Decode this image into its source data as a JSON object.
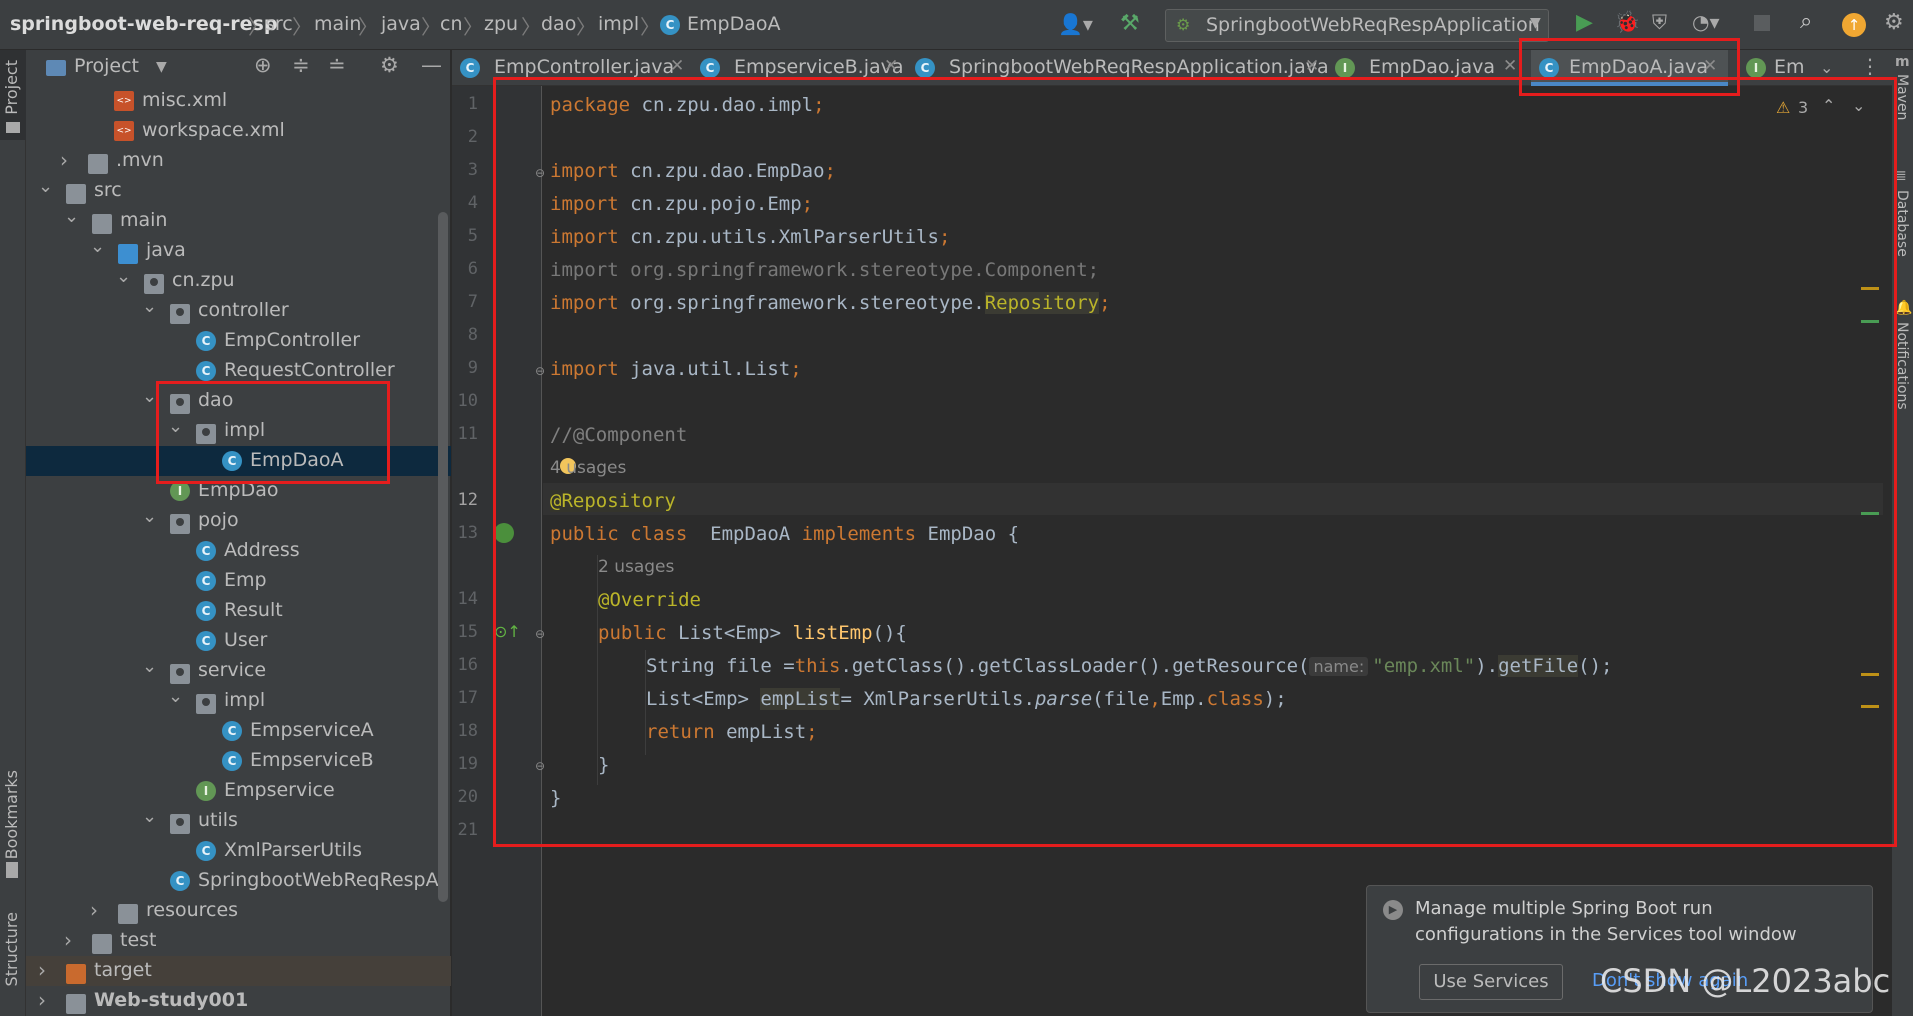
{
  "breadcrumb": {
    "project": "springboot-web-req-resp",
    "items": [
      "src",
      "main",
      "java",
      "cn",
      "zpu",
      "dao",
      "impl",
      "EmpDaoA"
    ]
  },
  "toolbar": {
    "run_config": "SpringbootWebReqRespApplication"
  },
  "left_strip": {
    "project": "Project",
    "bookmarks": "Bookmarks",
    "structure": "Structure"
  },
  "project_panel": {
    "title": "Project",
    "tree": [
      {
        "label": "misc.xml",
        "type": "xml"
      },
      {
        "label": "workspace.xml",
        "type": "xml"
      },
      {
        "label": ".mvn",
        "type": "folder"
      },
      {
        "label": "src",
        "type": "folder"
      },
      {
        "label": "main",
        "type": "folder"
      },
      {
        "label": "java",
        "type": "folder"
      },
      {
        "label": "cn.zpu",
        "type": "package"
      },
      {
        "label": "controller",
        "type": "package"
      },
      {
        "label": "EmpController",
        "type": "class"
      },
      {
        "label": "RequestController",
        "type": "class"
      },
      {
        "label": "dao",
        "type": "package"
      },
      {
        "label": "impl",
        "type": "package"
      },
      {
        "label": "EmpDaoA",
        "type": "class",
        "selected": true
      },
      {
        "label": "EmpDao",
        "type": "interface"
      },
      {
        "label": "pojo",
        "type": "package"
      },
      {
        "label": "Address",
        "type": "class"
      },
      {
        "label": "Emp",
        "type": "class"
      },
      {
        "label": "Result",
        "type": "class"
      },
      {
        "label": "User",
        "type": "class"
      },
      {
        "label": "service",
        "type": "package"
      },
      {
        "label": "impl",
        "type": "package"
      },
      {
        "label": "EmpserviceA",
        "type": "class"
      },
      {
        "label": "EmpserviceB",
        "type": "class"
      },
      {
        "label": "Empservice",
        "type": "interface"
      },
      {
        "label": "utils",
        "type": "package"
      },
      {
        "label": "XmlParserUtils",
        "type": "class"
      },
      {
        "label": "SpringbootWebReqRespA",
        "type": "class"
      },
      {
        "label": "resources",
        "type": "folder"
      },
      {
        "label": "test",
        "type": "folder"
      },
      {
        "label": "target",
        "type": "folder"
      },
      {
        "label": "Web-study001",
        "type": "folder"
      }
    ]
  },
  "tabs": [
    {
      "label": "EmpController.java",
      "icon": "class"
    },
    {
      "label": "EmpserviceB.java",
      "icon": "class"
    },
    {
      "label": "SpringbootWebReqRespApplication.java",
      "icon": "class"
    },
    {
      "label": "EmpDao.java",
      "icon": "interface"
    },
    {
      "label": "EmpDaoA.java",
      "icon": "class",
      "active": true
    },
    {
      "label": "Em",
      "icon": "interface"
    }
  ],
  "editor": {
    "warnings_count": "3",
    "line_numbers": [
      "1",
      "2",
      "3",
      "4",
      "5",
      "6",
      "7",
      "8",
      "9",
      "10",
      "11",
      "",
      "12",
      "13",
      "",
      "14",
      "15",
      "16",
      "17",
      "18",
      "19",
      "20",
      "21"
    ],
    "usages_4": "4 usages",
    "usages_2": "2 usages",
    "param_hint": "name:",
    "lines": {
      "l1": [
        "package ",
        "cn.zpu.dao.impl",
        ";"
      ],
      "l3": [
        "import ",
        "cn.zpu.dao.EmpDao",
        ";"
      ],
      "l4": [
        "import ",
        "cn.zpu.pojo.Emp",
        ";"
      ],
      "l5": [
        "import ",
        "cn.zpu.utils.XmlParserUtils",
        ";"
      ],
      "l6": "import org.springframework.stereotype.Component;",
      "l7": [
        "import ",
        "org.springframework.stereotype.",
        "Repository",
        ";"
      ],
      "l9": [
        "import ",
        "java.util.List",
        ";"
      ],
      "l11": "//@Component",
      "l12": "@Repository",
      "l13": [
        "public class ",
        " EmpDaoA ",
        "implements ",
        "EmpDao {"
      ],
      "l14": "@Override",
      "l15": [
        "public ",
        "List<Emp> ",
        "listEmp",
        "(){"
      ],
      "l16": [
        "String file =",
        "this",
        ".getClass().getClassLoader().getResource(",
        "\"emp.xml\"",
        ").",
        "getFile",
        "();"
      ],
      "l17": [
        "List<Emp> ",
        "empList",
        "= XmlParserUtils.",
        "parse",
        "(file",
        ",",
        "Emp.",
        "class",
        ");"
      ],
      "l18": [
        "return ",
        "empList",
        ";"
      ],
      "l19": "}",
      "l20": "}"
    }
  },
  "right_strip": {
    "maven": "Maven",
    "database": "Database",
    "notifications": "Notifications"
  },
  "notification": {
    "message": "Manage multiple Spring Boot run configurations in the Services tool window",
    "use_services": "Use Services",
    "dont_show": "Don't show again"
  },
  "watermark": "CSDN @L2023abc",
  "colors": {
    "accent": "#4a88c7",
    "highlight_box": "#e51d1d",
    "keyword": "#cc7832",
    "annotation": "#bbb529",
    "string": "#6a8759"
  }
}
